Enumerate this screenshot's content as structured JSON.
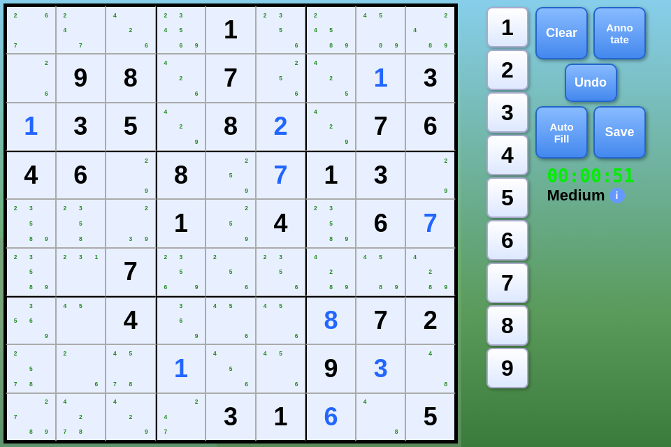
{
  "timer": "00:00:51",
  "difficulty": "Medium",
  "buttons": {
    "clear": "Clear",
    "annotate": "Anno\ntate",
    "undo": "Undo",
    "autofill": "Auto\nFill",
    "save": "Save"
  },
  "numbers": [
    "1",
    "2",
    "3",
    "4",
    "5",
    "6",
    "7",
    "8",
    "9"
  ],
  "grid": [
    [
      {
        "value": "",
        "anns": [
          "2",
          "",
          "6",
          "",
          "",
          "",
          "7",
          "",
          ""
        ],
        "blue": false
      },
      {
        "value": "",
        "anns": [
          "2",
          "",
          "",
          "4",
          "",
          "",
          "",
          "7",
          ""
        ],
        "blue": false
      },
      {
        "value": "",
        "anns": [
          "4",
          "",
          "",
          "",
          "2",
          "",
          "",
          "",
          "6"
        ],
        "blue": false
      },
      {
        "value": "",
        "anns": [
          "2",
          "3",
          "",
          "4",
          "5",
          "",
          "",
          "6",
          "9"
        ],
        "blue": false
      },
      {
        "value": "1",
        "anns": [],
        "blue": false
      },
      {
        "value": "",
        "anns": [
          "2",
          "3",
          "",
          "",
          "5",
          "",
          "",
          "",
          "6"
        ],
        "blue": false
      },
      {
        "value": "",
        "anns": [
          "2",
          "",
          "",
          "4",
          "5",
          "",
          "",
          "8",
          "9"
        ],
        "blue": false
      },
      {
        "value": "",
        "anns": [
          "4",
          "5",
          "",
          "",
          "",
          "",
          "",
          "8",
          "9"
        ],
        "blue": false
      },
      {
        "value": "",
        "anns": [
          "",
          "",
          "2",
          "4",
          "",
          "",
          "",
          "8",
          "9"
        ],
        "blue": false
      }
    ],
    [
      {
        "value": "",
        "anns": [
          "",
          "",
          "2",
          "",
          "",
          "",
          "",
          "",
          "6"
        ],
        "blue": false
      },
      {
        "value": "9",
        "anns": [],
        "blue": false
      },
      {
        "value": "8",
        "anns": [],
        "blue": false
      },
      {
        "value": "",
        "anns": [
          "4",
          "",
          "",
          "",
          "2",
          "",
          "",
          "",
          "6"
        ],
        "blue": false
      },
      {
        "value": "7",
        "anns": [],
        "blue": false
      },
      {
        "value": "",
        "anns": [
          "",
          "",
          "2",
          "",
          "5",
          "",
          "",
          "",
          "6"
        ],
        "blue": false
      },
      {
        "value": "",
        "anns": [
          "4",
          "",
          "",
          "",
          "2",
          "",
          "",
          "",
          "5"
        ],
        "blue": false
      },
      {
        "value": "1",
        "anns": [],
        "blue": true
      },
      {
        "value": "3",
        "anns": [],
        "blue": false
      }
    ],
    [
      {
        "value": "1",
        "anns": [],
        "blue": true
      },
      {
        "value": "3",
        "anns": [],
        "blue": false
      },
      {
        "value": "5",
        "anns": [],
        "blue": false
      },
      {
        "value": "",
        "anns": [
          "4",
          "",
          "",
          "",
          "2",
          "",
          "",
          "",
          "9"
        ],
        "blue": false
      },
      {
        "value": "8",
        "anns": [],
        "blue": false
      },
      {
        "value": "2",
        "anns": [],
        "blue": true
      },
      {
        "value": "",
        "anns": [
          "4",
          "",
          "",
          "",
          "2",
          "",
          "",
          "",
          "9"
        ],
        "blue": false
      },
      {
        "value": "7",
        "anns": [],
        "blue": false
      },
      {
        "value": "6",
        "anns": [],
        "blue": false
      }
    ],
    [
      {
        "value": "4",
        "anns": [],
        "blue": false
      },
      {
        "value": "6",
        "anns": [],
        "blue": false
      },
      {
        "value": "",
        "anns": [
          "",
          "",
          "2",
          "",
          "",
          "",
          "",
          "",
          "9"
        ],
        "blue": false
      },
      {
        "value": "8",
        "anns": [],
        "blue": false
      },
      {
        "value": "",
        "anns": [
          "",
          "",
          "2",
          "",
          "5",
          "",
          "",
          "",
          "9"
        ],
        "blue": false
      },
      {
        "value": "7",
        "anns": [],
        "blue": true
      },
      {
        "value": "1",
        "anns": [],
        "blue": false
      },
      {
        "value": "3",
        "anns": [],
        "blue": false
      },
      {
        "value": "",
        "anns": [
          "",
          "",
          "2",
          "",
          "",
          "",
          "",
          "",
          "9"
        ],
        "blue": false
      }
    ],
    [
      {
        "value": "",
        "anns": [
          "2",
          "3",
          "",
          "",
          "5",
          "",
          "",
          "8",
          "9"
        ],
        "blue": false
      },
      {
        "value": "",
        "anns": [
          "2",
          "3",
          "",
          "",
          "5",
          "",
          "",
          "8",
          ""
        ],
        "blue": false
      },
      {
        "value": "",
        "anns": [
          "",
          "",
          "2",
          "",
          "",
          "",
          "",
          "3",
          "9"
        ],
        "blue": false
      },
      {
        "value": "1",
        "anns": [],
        "blue": false
      },
      {
        "value": "",
        "anns": [
          "",
          "",
          "2",
          "",
          "5",
          "",
          "",
          "",
          "9"
        ],
        "blue": false
      },
      {
        "value": "4",
        "anns": [],
        "blue": false
      },
      {
        "value": "",
        "anns": [
          "2",
          "3",
          "",
          "",
          "5",
          "",
          "",
          "8",
          "9"
        ],
        "blue": false
      },
      {
        "value": "6",
        "anns": [],
        "blue": false
      },
      {
        "value": "7",
        "anns": [],
        "blue": true
      }
    ],
    [
      {
        "value": "",
        "anns": [
          "2",
          "3",
          "",
          "",
          "5",
          "",
          "",
          "8",
          "9"
        ],
        "blue": false
      },
      {
        "value": "",
        "anns": [
          "2",
          "3",
          "1",
          "",
          "",
          "",
          "",
          "",
          ""
        ],
        "blue": false
      },
      {
        "value": "7",
        "anns": [],
        "blue": false
      },
      {
        "value": "",
        "anns": [
          "2",
          "3",
          "",
          "",
          "5",
          "",
          "6",
          "",
          "9"
        ],
        "blue": false
      },
      {
        "value": "",
        "anns": [
          "2",
          "",
          "",
          "",
          "5",
          "",
          "",
          "",
          "6"
        ],
        "blue": false
      },
      {
        "value": "",
        "anns": [
          "2",
          "3",
          "",
          "",
          "5",
          "",
          "",
          "",
          "6"
        ],
        "blue": false
      },
      {
        "value": "",
        "anns": [
          "4",
          "",
          "",
          "",
          "2",
          "",
          "",
          "8",
          "9"
        ],
        "blue": false
      },
      {
        "value": "",
        "anns": [
          "4",
          "5",
          "",
          "",
          "",
          "",
          "",
          "8",
          "9"
        ],
        "blue": false
      },
      {
        "value": "",
        "anns": [
          "4",
          "",
          "",
          "",
          "2",
          "",
          "",
          "8",
          "9"
        ],
        "blue": false
      }
    ],
    [
      {
        "value": "",
        "anns": [
          "",
          "3",
          "",
          "5",
          "6",
          "",
          "",
          "",
          "9"
        ],
        "blue": false
      },
      {
        "value": "",
        "anns": [
          "4",
          "5",
          "",
          "",
          "",
          "",
          "",
          "",
          ""
        ],
        "blue": false
      },
      {
        "value": "4",
        "anns": [],
        "blue": false
      },
      {
        "value": "",
        "anns": [
          "",
          "3",
          "",
          "",
          "6",
          "",
          "",
          "",
          "9"
        ],
        "blue": false
      },
      {
        "value": "",
        "anns": [
          "4",
          "5",
          "",
          "",
          "",
          "",
          "",
          "",
          "6"
        ],
        "blue": false
      },
      {
        "value": "",
        "anns": [
          "4",
          "5",
          "",
          "",
          "",
          "",
          "",
          "",
          "6"
        ],
        "blue": false
      },
      {
        "value": "8",
        "anns": [],
        "blue": true
      },
      {
        "value": "7",
        "anns": [],
        "blue": false
      },
      {
        "value": "2",
        "anns": [],
        "blue": false
      }
    ],
    [
      {
        "value": "",
        "anns": [
          "2",
          "",
          "",
          "",
          "5",
          "",
          "7",
          "8",
          ""
        ],
        "blue": false
      },
      {
        "value": "",
        "anns": [
          "2",
          "",
          "",
          "",
          "",
          "",
          "",
          "",
          "6"
        ],
        "blue": false
      },
      {
        "value": "",
        "anns": [
          "4",
          "5",
          "",
          "",
          "",
          "",
          "7",
          "8",
          ""
        ],
        "blue": false
      },
      {
        "value": "1",
        "anns": [],
        "blue": true
      },
      {
        "value": "",
        "anns": [
          "4",
          "",
          "",
          "",
          "5",
          "",
          "",
          "",
          "6"
        ],
        "blue": false
      },
      {
        "value": "",
        "anns": [
          "4",
          "5",
          "",
          "",
          "",
          "",
          "",
          "",
          "6"
        ],
        "blue": false
      },
      {
        "value": "9",
        "anns": [],
        "blue": false
      },
      {
        "value": "3",
        "anns": [],
        "blue": true
      },
      {
        "value": "",
        "anns": [
          "",
          "4",
          "",
          "",
          "",
          "",
          "",
          "",
          "8"
        ],
        "blue": false
      }
    ],
    [
      {
        "value": "",
        "anns": [
          "",
          "",
          "2",
          "7",
          "",
          "",
          "",
          "8",
          "9"
        ],
        "blue": false
      },
      {
        "value": "",
        "anns": [
          "4",
          "",
          "",
          "",
          "2",
          "",
          "7",
          "8",
          ""
        ],
        "blue": false
      },
      {
        "value": "",
        "anns": [
          "4",
          "",
          "",
          "",
          "2",
          "",
          "",
          "",
          "9"
        ],
        "blue": false
      },
      {
        "value": "",
        "anns": [
          "",
          "",
          "2",
          "4",
          "",
          "",
          "7",
          "",
          ""
        ],
        "blue": false
      },
      {
        "value": "3",
        "anns": [],
        "blue": false
      },
      {
        "value": "1",
        "anns": [],
        "blue": false
      },
      {
        "value": "6",
        "anns": [],
        "blue": true
      },
      {
        "value": "",
        "anns": [
          "4",
          "",
          "",
          "",
          "",
          "",
          "",
          "",
          "8"
        ],
        "blue": false
      },
      {
        "value": "5",
        "anns": [],
        "blue": false
      }
    ]
  ],
  "info_icon": "i"
}
